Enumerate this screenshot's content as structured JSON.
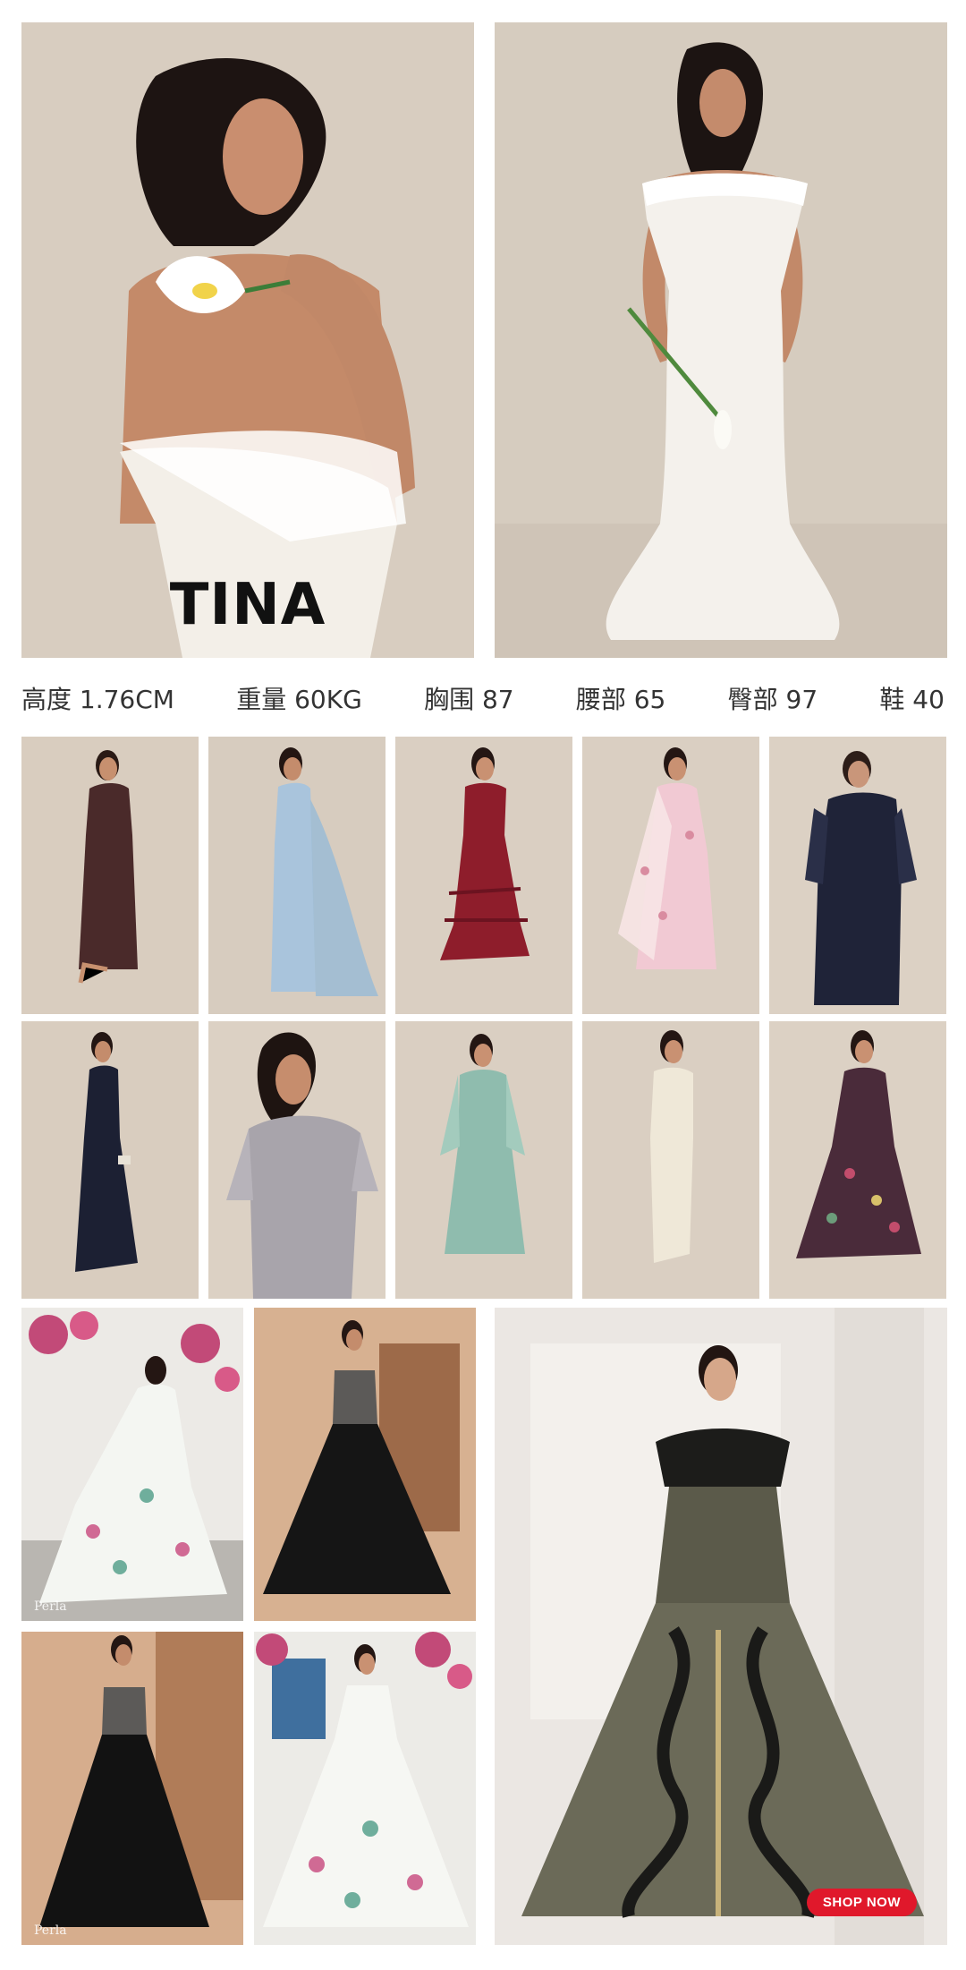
{
  "hero": {
    "model_name": "TINA"
  },
  "stats": [
    {
      "label": "高度 1.76CM"
    },
    {
      "label": "重量 60KG"
    },
    {
      "label": "胸围 87"
    },
    {
      "label": "腰部 65"
    },
    {
      "label": "臀部 97"
    },
    {
      "label": "鞋 40"
    }
  ],
  "cta": {
    "label": "SHOP NOW"
  },
  "logos": {
    "left_watermark_1": "Perla",
    "left_watermark_2": "Perla"
  },
  "colors": {
    "studio_bg": "#d9cec2",
    "white_gown": "#f4f1ec",
    "cta": "#e0182b"
  },
  "gowns": [
    {
      "color": "#4a2a2a"
    },
    {
      "color": "#a9c4dc"
    },
    {
      "color": "#8e1d2b"
    },
    {
      "color": "#f1c9d3"
    },
    {
      "color": "#1f2338"
    },
    {
      "color": "#1c2033"
    },
    {
      "color": "#a8a4ab"
    },
    {
      "color": "#8fbcae"
    },
    {
      "color": "#efe8d8"
    },
    {
      "color": "#4a2b3a"
    }
  ]
}
